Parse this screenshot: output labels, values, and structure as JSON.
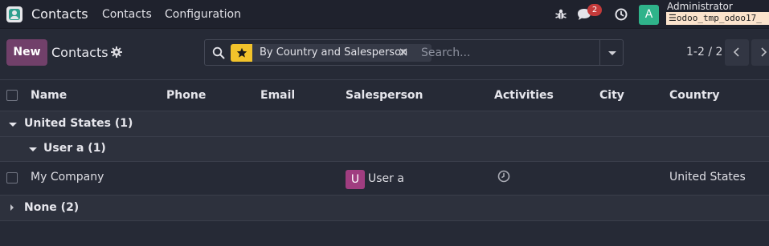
{
  "navbar": {
    "app_name": "Contacts",
    "menus": [
      "Contacts",
      "Configuration"
    ],
    "chat_count": "2",
    "avatar_letter": "A",
    "user_name": "Administrator",
    "database": "odoo_tmp_odoo17_"
  },
  "control": {
    "new_label": "New",
    "breadcrumb": "Contacts",
    "facet_label": "By Country and Salesperson",
    "search_placeholder": "Search...",
    "pager": "1-2 / 2"
  },
  "table": {
    "columns": [
      "Name",
      "Phone",
      "Email",
      "Salesperson",
      "Activities",
      "City",
      "Country"
    ]
  },
  "groups": {
    "us": "United States (1)",
    "user_a": "User a (1)",
    "none": "None (2)"
  },
  "row": {
    "name": "My Company",
    "salesperson_initial": "U",
    "salesperson": "User a",
    "country": "United States"
  },
  "colors": {
    "primary": "#71406a",
    "background": "#262a36",
    "navbar": "#1f222d",
    "facet_star": "#f2c32b",
    "badge": "#c43a3a"
  }
}
